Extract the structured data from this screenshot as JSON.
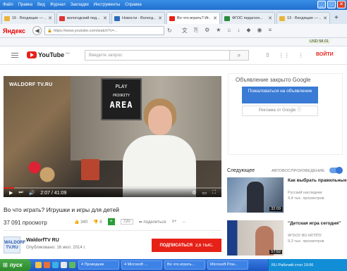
{
  "window": {
    "menu": [
      "Файл",
      "Правка",
      "Вид",
      "Журнал",
      "Закладки",
      "Инструменты",
      "Справка"
    ]
  },
  "tabs": [
    {
      "title": "16 · Входящие — ...",
      "color": "#e8b43a",
      "active": false
    },
    {
      "title": "вологодский пед...",
      "color": "#d33",
      "active": false
    },
    {
      "title": "Новости - Вологд...",
      "color": "#2c6bb8",
      "active": false
    },
    {
      "title": "Во что играть? Иг...",
      "color": "#e62117",
      "active": true
    },
    {
      "title": "ФГОС педагоги...",
      "color": "#2a8a3d",
      "active": false
    },
    {
      "title": "13 · Входящие — ...",
      "color": "#e8b43a",
      "active": false
    }
  ],
  "nav": {
    "logo": "Яндекс",
    "url": "https://www.youtube.com/watch?v=...",
    "usd": "USD 58.01"
  },
  "youtube": {
    "logo_text": "YouTube",
    "region": "RU",
    "search_placeholder": "Введите запрос",
    "login": "ВОЙТИ"
  },
  "player": {
    "brand": "WALDORF TV.RU",
    "sign_line1": "PLAY",
    "sign_line2": "PRIORITY",
    "sign_line3": "AREA",
    "time": "2:07 / 41:09",
    "progress": 0.05
  },
  "video": {
    "title": "Во что играть? Игрушки и игры для детей",
    "views": "37 091 просмотр",
    "likes": "340",
    "dislikes": "8",
    "quality": "720",
    "share": "поделиться",
    "more": "..."
  },
  "channel": {
    "avatar_text": "WALDORF TV.RU",
    "name": "WaldorfTV RU",
    "date": "Опубликовано: 16 июл. 2014 г.",
    "subscribe": "ПОДПИСАТЬСЯ",
    "subscribers": "2,6 ТЫС."
  },
  "ad": {
    "title": "Объявление закрыто Google",
    "button1": "Пожаловаться на объявление",
    "button2": "Реклама от Google ⓘ"
  },
  "next": {
    "label": "Следующее",
    "autoplay": "АВТОВОСПРОИЗВЕДЕНИЕ"
  },
  "recommendations": [
    {
      "title": "Как выбрать правильные",
      "channel": "Русский наследник",
      "views": "4,4 тыс. просмотров",
      "duration": "32:09"
    },
    {
      "title": "\"Детская игра сегодня\"",
      "channel": "ФГБОУ ВО МГППУ",
      "views": "9,3 тыс. просмотров",
      "duration": "57:52"
    }
  ],
  "taskbar": {
    "start": "пуск",
    "tasks": [
      "4 Проводник",
      "4 Microsoft ...",
      "Во что играть...",
      "Microsoft Pow..."
    ],
    "tray": "RU  Рабочий стол  19:06"
  }
}
